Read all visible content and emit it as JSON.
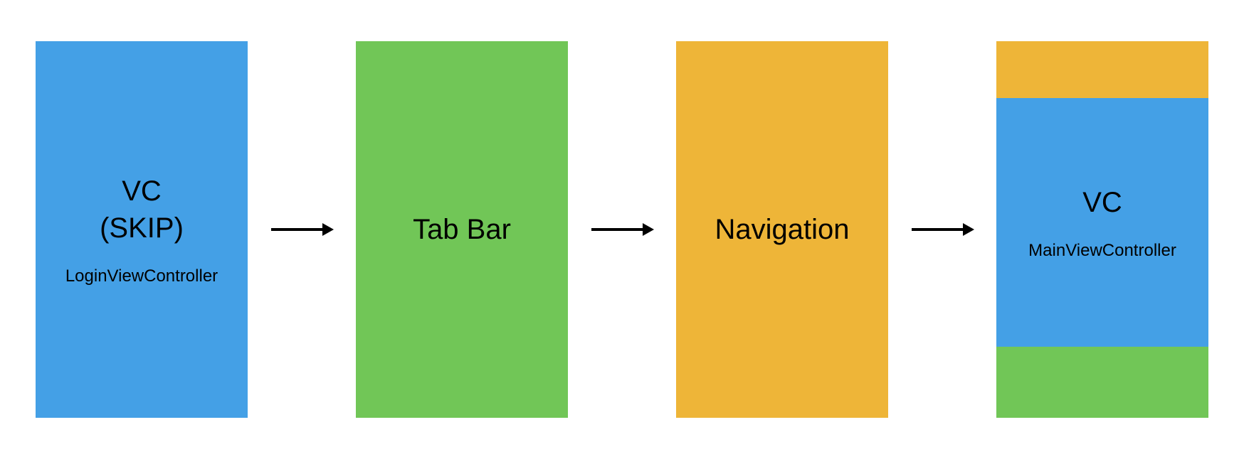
{
  "colors": {
    "blue": "#44a0e6",
    "green": "#71c657",
    "yellow": "#eeb538"
  },
  "boxes": {
    "login": {
      "title_line1": "VC",
      "title_line2": "(SKIP)",
      "subtitle": "LoginViewController"
    },
    "tabbar": {
      "title": "Tab Bar"
    },
    "navigation": {
      "title": "Navigation"
    },
    "main": {
      "title": "VC",
      "subtitle": "MainViewController"
    }
  }
}
